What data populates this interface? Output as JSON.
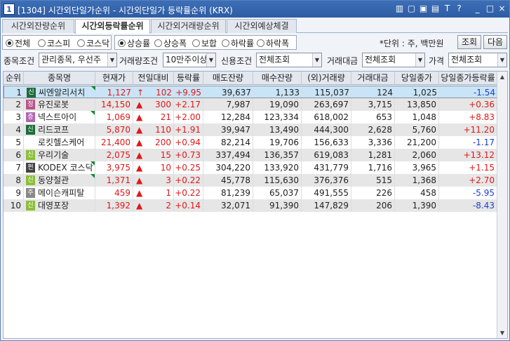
{
  "window": {
    "number": "1",
    "title": "[1304] 시간외단일가순위 - 시간외단일가 등락률순위 (KRX)",
    "controls": [
      "▥",
      "▢",
      "▣",
      "▤",
      "T",
      "?",
      "_",
      "□",
      "×"
    ]
  },
  "tabs": [
    "시간외잔량순위",
    "시간외등락률순위",
    "시간외거래량순위",
    "시간외예상체결"
  ],
  "active_tab": 1,
  "market_filter": {
    "options": [
      "전체",
      "코스피",
      "코스닥"
    ],
    "selected": 0
  },
  "change_filter": {
    "options": [
      "상승률",
      "상승폭",
      "보합",
      "하락률",
      "하락폭"
    ],
    "selected": 0
  },
  "unit_label": "*단위 : 주, 백만원",
  "buttons": {
    "query": "조회",
    "next": "다음"
  },
  "conditions": {
    "stock_label": "종목조건",
    "stock_value": "관리종목, 우선주",
    "volume_label": "거래량조건",
    "volume_value": "10만주이상",
    "credit_label": "신용조건",
    "credit_value": "전체조회",
    "amount_label": "거래대금",
    "amount_value": "전체조회",
    "price_label": "가격",
    "price_value": "전체조회"
  },
  "columns": [
    "순위",
    "종목명",
    "현재가",
    "전일대비",
    "등락률",
    "매도잔량",
    "매수잔량",
    "(외)거래량",
    "거래대금",
    "당일종가",
    "당일종가등락률"
  ],
  "rows": [
    {
      "rank": "1",
      "badge": "신",
      "badge_color": "#1e6b3a",
      "name": "씨엔알리서치",
      "flag": true,
      "price": "1,127",
      "arrow": "↑",
      "diff": "102",
      "rate": "+9.95",
      "ask": "39,637",
      "bid": "1,133",
      "volume": "115,037",
      "amount": "124",
      "close": "1,025",
      "close_rate": "-1.54",
      "close_dir": "down"
    },
    {
      "rank": "2",
      "badge": "정",
      "badge_color": "#b9548a",
      "name": "유진로봇",
      "flag": false,
      "price": "14,150",
      "arrow": "▲",
      "diff": "300",
      "rate": "+2.17",
      "ask": "7,987",
      "bid": "19,090",
      "volume": "263,697",
      "amount": "3,715",
      "close": "13,850",
      "close_rate": "+0.36",
      "close_dir": "up"
    },
    {
      "rank": "3",
      "badge": "증",
      "badge_color": "#b066b0",
      "name": "넥스트아이",
      "flag": true,
      "price": "1,069",
      "arrow": "▲",
      "diff": "21",
      "rate": "+2.00",
      "ask": "12,284",
      "bid": "123,334",
      "volume": "618,002",
      "amount": "653",
      "close": "1,048",
      "close_rate": "+8.83",
      "close_dir": "up"
    },
    {
      "rank": "4",
      "badge": "신",
      "badge_color": "#1e6b3a",
      "name": "리드코프",
      "flag": false,
      "price": "5,870",
      "arrow": "▲",
      "diff": "110",
      "rate": "+1.91",
      "ask": "39,947",
      "bid": "13,490",
      "volume": "444,300",
      "amount": "2,628",
      "close": "5,760",
      "close_rate": "+11.20",
      "close_dir": "up"
    },
    {
      "rank": "5",
      "badge": "",
      "badge_color": "",
      "name": "로킷헬스케어",
      "flag": false,
      "price": "21,400",
      "arrow": "▲",
      "diff": "200",
      "rate": "+0.94",
      "ask": "82,214",
      "bid": "19,706",
      "volume": "156,633",
      "amount": "3,336",
      "close": "21,200",
      "close_rate": "-1.17",
      "close_dir": "down"
    },
    {
      "rank": "6",
      "badge": "신",
      "badge_color": "#8bbf3a",
      "name": "우리기술",
      "flag": false,
      "price": "2,075",
      "arrow": "▲",
      "diff": "15",
      "rate": "+0.73",
      "ask": "337,494",
      "bid": "136,357",
      "volume": "619,083",
      "amount": "1,281",
      "close": "2,060",
      "close_rate": "+13.12",
      "close_dir": "up"
    },
    {
      "rank": "7",
      "badge": "펀",
      "badge_color": "#444444",
      "name": "KODEX 코스닥",
      "flag": true,
      "price": "3,975",
      "arrow": "▲",
      "diff": "10",
      "rate": "+0.25",
      "ask": "304,220",
      "bid": "133,920",
      "volume": "431,779",
      "amount": "1,716",
      "close": "3,965",
      "close_rate": "+1.15",
      "close_dir": "up"
    },
    {
      "rank": "8",
      "badge": "신",
      "badge_color": "#8bbf3a",
      "name": "동양철관",
      "flag": true,
      "price": "1,371",
      "arrow": "▲",
      "diff": "3",
      "rate": "+0.22",
      "ask": "45,778",
      "bid": "115,630",
      "volume": "376,376",
      "amount": "515",
      "close": "1,368",
      "close_rate": "+2.70",
      "close_dir": "up"
    },
    {
      "rank": "9",
      "badge": "주",
      "badge_color": "#888888",
      "name": "메이슨캐피탈",
      "flag": false,
      "price": "459",
      "arrow": "▲",
      "diff": "1",
      "rate": "+0.22",
      "ask": "81,239",
      "bid": "65,037",
      "volume": "491,555",
      "amount": "226",
      "close": "458",
      "close_rate": "-5.95",
      "close_dir": "down"
    },
    {
      "rank": "10",
      "badge": "신",
      "badge_color": "#8bbf3a",
      "name": "대영포장",
      "flag": false,
      "price": "1,392",
      "arrow": "▲",
      "diff": "2",
      "rate": "+0.14",
      "ask": "32,071",
      "bid": "91,390",
      "volume": "147,829",
      "amount": "206",
      "close": "1,390",
      "close_rate": "-8.43",
      "close_dir": "down"
    }
  ],
  "colors": {
    "up": "#e01818",
    "down": "#1a3fd0",
    "selected_row": "#c9e4f6",
    "alt_row": "#e6e6e6"
  }
}
